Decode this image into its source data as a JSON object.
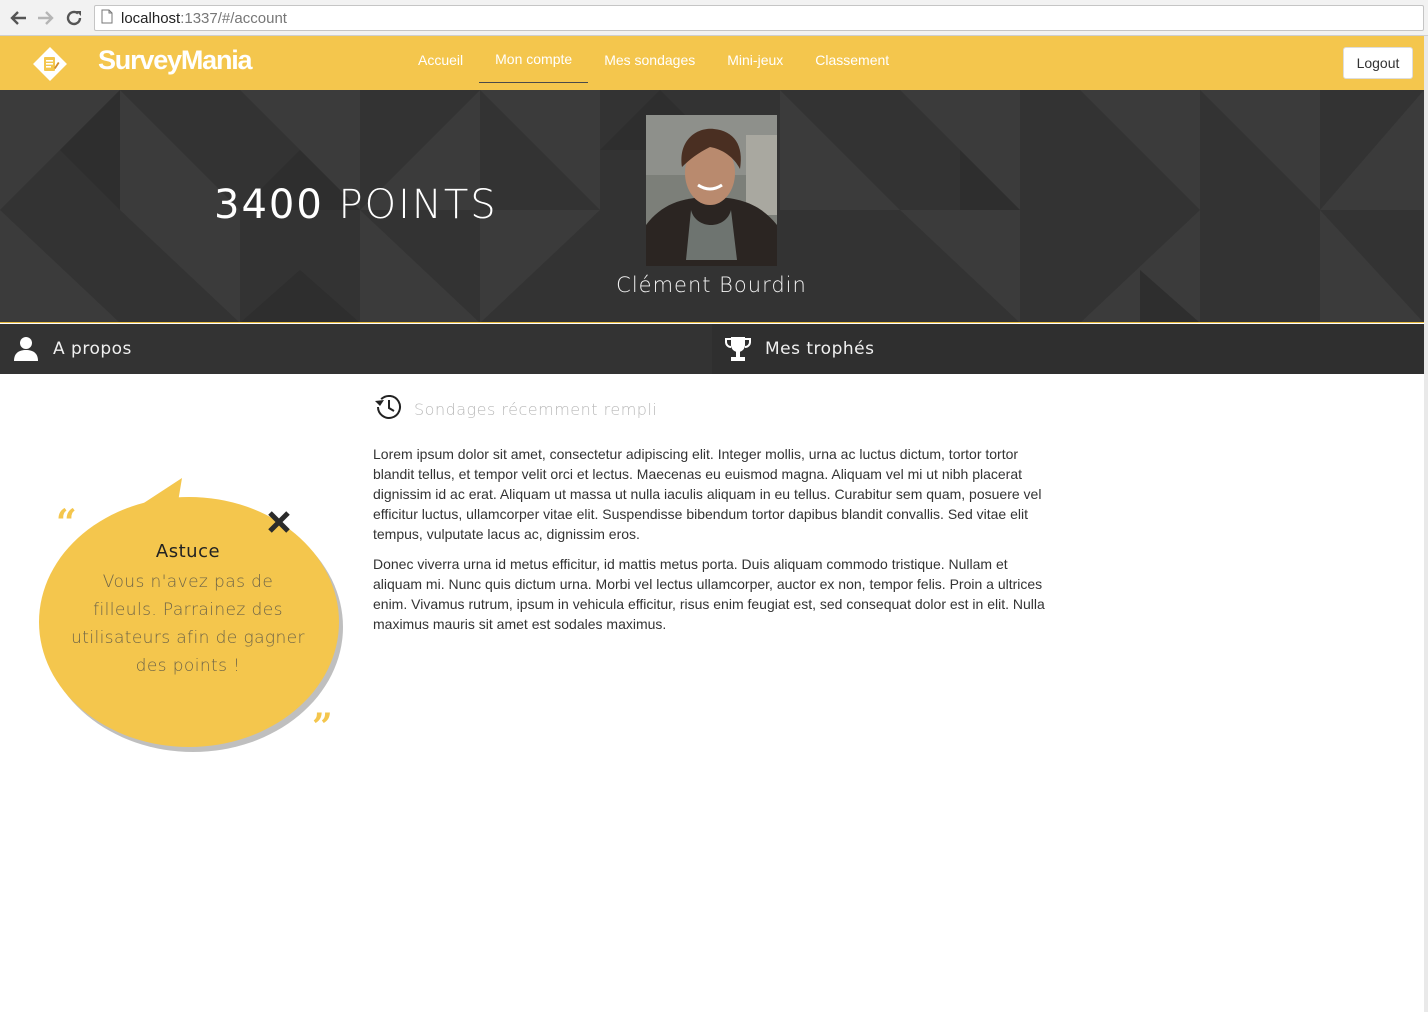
{
  "browser": {
    "url_host": "localhost",
    "url_rest": ":1337/#/account"
  },
  "navbar": {
    "brand": "SurveyMania",
    "links": [
      "Accueil",
      "Mon compte",
      "Mes sondages",
      "Mini-jeux",
      "Classement"
    ],
    "active_link": "Mon compte",
    "logout_label": "Logout",
    "accent_color": "#f4c64d"
  },
  "profile": {
    "points_value": "3400",
    "points_unit": "POINTS",
    "name": "Clément Bourdin"
  },
  "tabs": {
    "about_label": "A propos",
    "trophies_label": "Mes trophés"
  },
  "recent": {
    "heading": "Sondages récemment rempli",
    "paragraph1": "Lorem ipsum dolor sit amet, consectetur adipiscing elit. Integer mollis, urna ac luctus dictum, tortor tortor blandit tellus, et tempor velit orci et lectus. Maecenas eu euismod magna. Aliquam vel mi ut nibh placerat dignissim id ac erat. Aliquam ut massa ut nulla iaculis aliquam in eu tellus. Curabitur sem quam, posuere vel efficitur luctus, ullamcorper vitae elit. Suspendisse bibendum tortor dapibus blandit convallis. Sed vitae elit tempus, vulputate lacus ac, dignissim eros.",
    "paragraph2": "Donec viverra urna id metus efficitur, id mattis metus porta. Duis aliquam commodo tristique. Nullam et aliquam mi. Nunc quis dictum urna. Morbi vel lectus ullamcorper, auctor ex non, tempor felis. Proin a ultrices enim. Vivamus rutrum, ipsum in vehicula efficitur, risus enim feugiat est, sed consequat dolor est in elit. Nulla maximus mauris sit amet est sodales maximus."
  },
  "tip": {
    "title": "Astuce",
    "text": "Vous n'avez pas de filleuls. Parrainez des utilisateurs afin de gagner des points !",
    "quote_open": "“",
    "quote_close": "”"
  }
}
